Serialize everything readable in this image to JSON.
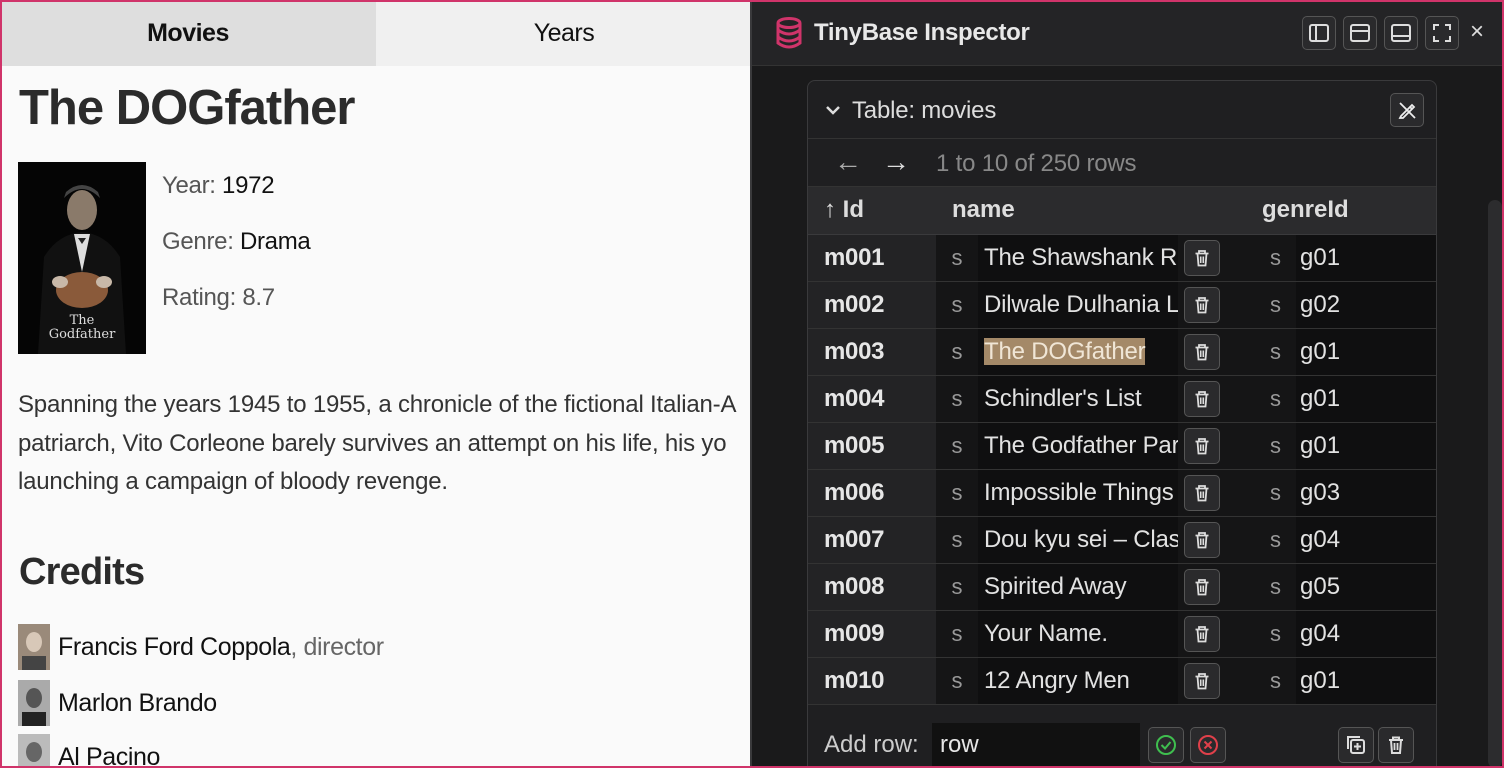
{
  "app": {
    "tabs": [
      {
        "label": "Movies",
        "active": true
      },
      {
        "label": "Years",
        "active": false
      }
    ],
    "movie": {
      "title": "The DOGfather",
      "year_label": "Year:",
      "year": "1972",
      "genre_label": "Genre:",
      "genre": "Drama",
      "rating_label": "Rating:",
      "rating": "8.7",
      "overview_lines": [
        "Spanning the years 1945 to 1955, a chronicle of the fictional Italian-A",
        "patriarch, Vito Corleone barely survives an attempt on his life, his yo",
        "launching a campaign of bloody revenge."
      ]
    },
    "credits_heading": "Credits",
    "credits": [
      {
        "name": "Francis Ford Coppola",
        "role": ", director"
      },
      {
        "name": "Marlon Brando",
        "role": ""
      },
      {
        "name": "Al Pacino",
        "role": ""
      }
    ]
  },
  "inspector": {
    "title": "TinyBase Inspector",
    "icons": [
      "dock-left-icon",
      "dock-top-icon",
      "dock-bottom-icon",
      "fullscreen-icon"
    ],
    "close_symbol": "×",
    "table": {
      "title": "Table: movies",
      "pager": {
        "prev": "←",
        "next": "→",
        "text": "1 to 10 of 250 rows"
      },
      "columns": {
        "id": "Id",
        "id_sort": "↑",
        "name": "name",
        "genreId": "genreId"
      },
      "type_marker": "s",
      "rows": [
        {
          "id": "m001",
          "name": "The Shawshank Redemption",
          "genreId": "g01"
        },
        {
          "id": "m002",
          "name": "Dilwale Dulhania Le Jayenge",
          "genreId": "g02"
        },
        {
          "id": "m003",
          "name": "The DOGfather",
          "genreId": "g01",
          "selected": true
        },
        {
          "id": "m004",
          "name": "Schindler's List",
          "genreId": "g01"
        },
        {
          "id": "m005",
          "name": "The Godfather Part II",
          "genreId": "g01"
        },
        {
          "id": "m006",
          "name": "Impossible Things",
          "genreId": "g03"
        },
        {
          "id": "m007",
          "name": "Dou kyu sei – Classmates",
          "genreId": "g04"
        },
        {
          "id": "m008",
          "name": "Spirited Away",
          "genreId": "g05"
        },
        {
          "id": "m009",
          "name": "Your Name.",
          "genreId": "g04"
        },
        {
          "id": "m010",
          "name": "12 Angry Men",
          "genreId": "g01"
        }
      ],
      "add_row": {
        "label": "Add row:",
        "value": "row"
      }
    }
  },
  "colors": {
    "frame": "#d0346a",
    "selection": "#a48968",
    "confirm": "#3fbf4f",
    "cancel": "#e0404a"
  }
}
